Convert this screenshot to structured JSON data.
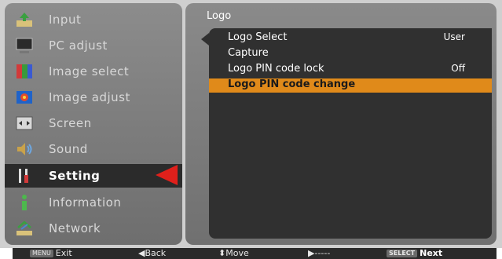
{
  "menu": {
    "items": [
      {
        "label": "Input",
        "icon": "input-icon"
      },
      {
        "label": "PC adjust",
        "icon": "pc-adjust-icon"
      },
      {
        "label": "Image select",
        "icon": "image-select-icon"
      },
      {
        "label": "Image adjust",
        "icon": "image-adjust-icon"
      },
      {
        "label": "Screen",
        "icon": "screen-icon"
      },
      {
        "label": "Sound",
        "icon": "sound-icon"
      },
      {
        "label": "Setting",
        "icon": "setting-icon"
      },
      {
        "label": "Information",
        "icon": "information-icon"
      },
      {
        "label": "Network",
        "icon": "network-icon"
      }
    ],
    "selected": "Setting"
  },
  "submenu": {
    "title": "Logo",
    "rows": [
      {
        "label": "Logo Select",
        "value": "User"
      },
      {
        "label": "Capture",
        "value": ""
      },
      {
        "label": "Logo PIN code lock",
        "value": "Off"
      },
      {
        "label": "Logo PIN code change",
        "value": ""
      }
    ],
    "highlighted": "Logo PIN code change"
  },
  "footer": {
    "exit_chip": "MENU",
    "exit_label": "Exit",
    "back_label": "Back",
    "move_label": "Move",
    "right_label": "-----",
    "next_chip": "SELECT",
    "next_label": "Next"
  },
  "colors": {
    "highlight": "#e08a1a",
    "selection_arrow": "#e0201b"
  }
}
